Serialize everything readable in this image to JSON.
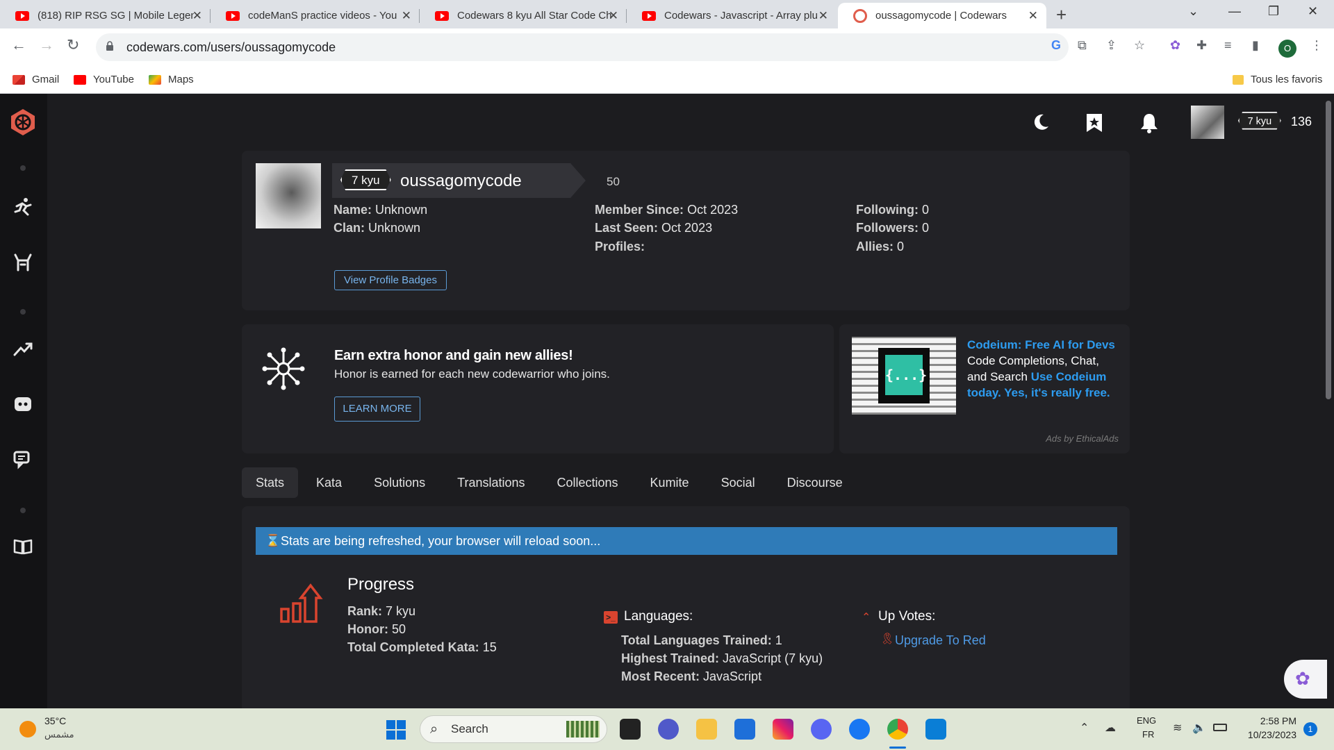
{
  "browser": {
    "tabs": [
      {
        "title": "(818) RIP RSG SG | Mobile Legen",
        "icon": "youtube-icon"
      },
      {
        "title": "codeManS practice videos - You",
        "icon": "youtube-icon"
      },
      {
        "title": "Codewars 8 kyu All Star Code Ch",
        "icon": "youtube-icon"
      },
      {
        "title": "Codewars - Javascript - Array plu",
        "icon": "youtube-icon"
      },
      {
        "title": "oussagomycode | Codewars",
        "icon": "codewars-icon"
      }
    ],
    "url": "codewars.com/users/oussagomycode",
    "profile_initial": "O",
    "bookmarks": [
      "Gmail",
      "YouTube",
      "Maps"
    ],
    "all_bookmarks": "Tous les favoris"
  },
  "header": {
    "rank": "7 kyu",
    "honor": "136"
  },
  "profile": {
    "rank": "7 kyu",
    "username": "oussagomycode",
    "honor": "50",
    "name_label": "Name:",
    "name": "Unknown",
    "clan_label": "Clan:",
    "clan": "Unknown",
    "member_since_label": "Member Since:",
    "member_since": "Oct 2023",
    "last_seen_label": "Last Seen:",
    "last_seen": "Oct 2023",
    "profiles_label": "Profiles:",
    "following_label": "Following:",
    "following": "0",
    "followers_label": "Followers:",
    "followers": "0",
    "allies_label": "Allies:",
    "allies": "0",
    "badges_button": "View Profile Badges"
  },
  "promo": {
    "title": "Earn extra honor and gain new allies!",
    "text": "Honor is earned for each new codewarrior who joins.",
    "button": "LEARN MORE"
  },
  "ad": {
    "headline": "Codeium: Free AI for Devs",
    "line1": "Code Completions, Chat,",
    "line2_prefix": "and Search ",
    "line2_link": "Use Codeium",
    "line3": "today. Yes, it's really free.",
    "footer": "Ads by EthicalAds"
  },
  "tabs": [
    "Stats",
    "Kata",
    "Solutions",
    "Translations",
    "Collections",
    "Kumite",
    "Social",
    "Discourse"
  ],
  "stats": {
    "banner": "Stats are being refreshed, your browser will reload soon...",
    "progress_title": "Progress",
    "rank_label": "Rank:",
    "rank": "7 kyu",
    "honor_label": "Honor:",
    "honor": "50",
    "completed_label": "Total Completed Kata:",
    "completed": "15",
    "languages_title": "Languages:",
    "total_lang_label": "Total Languages Trained:",
    "total_lang": "1",
    "highest_label": "Highest Trained:",
    "highest": "JavaScript (7 kyu)",
    "recent_label": "Most Recent:",
    "recent": "JavaScript",
    "upvotes_title": "Up Votes:",
    "upgrade_link": "Upgrade To Red"
  },
  "taskbar": {
    "temperature": "35°C",
    "weather": "مشمس",
    "search": "Search",
    "lang1": "ENG",
    "lang2": "FR",
    "time": "2:58 PM",
    "date": "10/23/2023",
    "notifications": "1"
  }
}
